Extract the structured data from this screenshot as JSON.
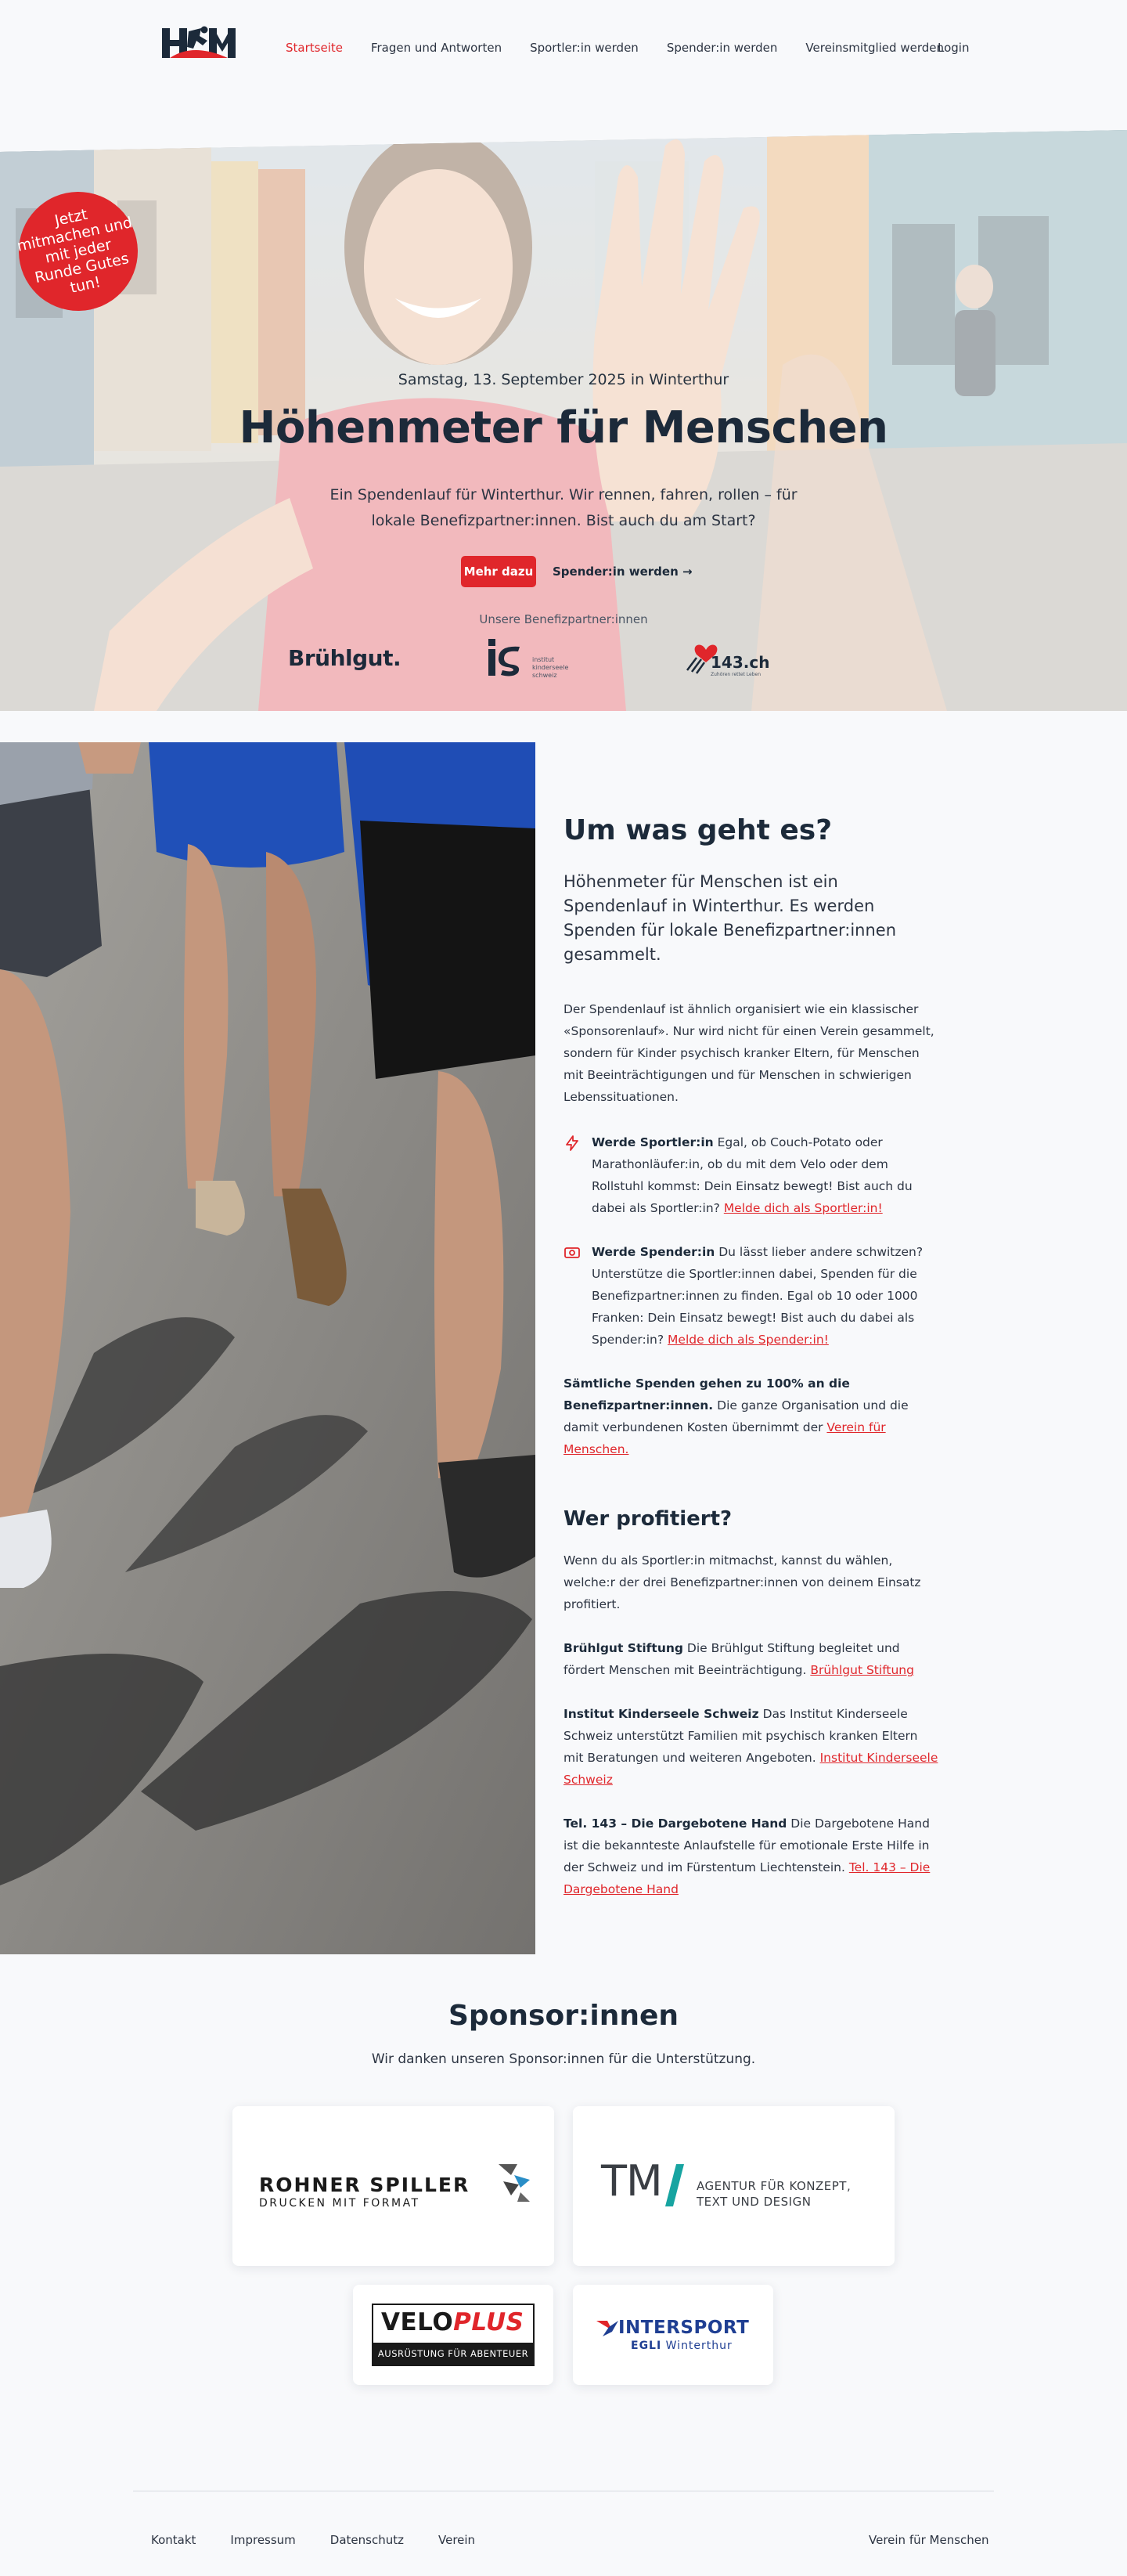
{
  "nav": {
    "logo_alt": "HfM",
    "items": [
      {
        "label": "Startseite",
        "active": true
      },
      {
        "label": "Fragen und Antworten"
      },
      {
        "label": "Sportler:in werden"
      },
      {
        "label": "Spender:in werden"
      },
      {
        "label": "Vereinsmitglied werden"
      }
    ],
    "login": "Login"
  },
  "hero": {
    "badge": "Jetzt mitmachen und mit jeder Runde Gutes tun!",
    "date": "Samstag, 13. September 2025 in Winterthur",
    "title": "Höhenmeter für Menschen",
    "description": "Ein Spendenlauf für Winterthur. Wir rennen, fahren, rollen – für lokale Benefizpartner:innen. Bist auch du am Start?",
    "primary_button": "Mehr dazu",
    "secondary_button": "Spender:in werden →",
    "partners_label": "Unsere Benefizpartner:innen",
    "partners": {
      "bruehlgut": "Brühlgut.",
      "iks_line1": "institut",
      "iks_line2": "kinderseele",
      "iks_line3": "schweiz",
      "tel143": "143.ch",
      "tel143_sub": "Zuhören rettet Leben"
    }
  },
  "about": {
    "title": "Um was geht es?",
    "lead": "Höhenmeter für Menschen ist ein Spendenlauf in Winterthur. Es werden Spenden für lokale Benefizpartner:innen gesammelt.",
    "intro": "Der Spendenlauf ist ähnlich organisiert wie ein klassischer «Sponsorenlauf». Nur wird nicht für einen Verein gesammelt, sondern für Kinder psychisch kranker Eltern, für Menschen mit Beeinträchtigungen und für Menschen in schwierigen Lebenssituationen.",
    "athlete_title": "Werde Sportler:in",
    "athlete_text": " Egal, ob Couch-Potato oder Marathonläufer:in, ob du mit dem Velo oder dem Rollstuhl kommst: Dein Einsatz bewegt! Bist auch du dabei als Sportler:in? ",
    "athlete_link": "Melde dich als Sportler:in!",
    "donor_title": "Werde Spender:in",
    "donor_text": " Du lässt lieber andere schwitzen? Unterstütze die Sportler:innen dabei, Spenden für die Benefizpartner:innen zu finden. Egal ob 10 oder 1000 Franken: Dein Einsatz bewegt! Bist auch du dabei als Spender:in? ",
    "donor_link": "Melde dich als Spender:in!",
    "all_title": "Sämtliche Spenden gehen zu 100% an die Benefizpartner:innen.",
    "all_text": " Die ganze Organisation und die damit verbundenen Kosten übernimmt der ",
    "all_link": "Verein für Menschen."
  },
  "benefit": {
    "title": "Wer profitiert?",
    "intro": "Wenn du als Sportler:in mitmachst, kannst du wählen, welche:r der drei Benefizpartner:innen von deinem Einsatz profitiert.",
    "p1_title": "Brühlgut Stiftung",
    "p1_text": " Die Brühlgut Stiftung begleitet und fördert Menschen mit Beeinträchtigung. ",
    "p1_link": "Brühlgut Stiftung",
    "p2_title": "Institut Kinderseele Schweiz",
    "p2_text": " Das Institut Kinderseele Schweiz unterstützt Familien mit psychisch kranken Eltern mit Beratungen und weiteren Angeboten. ",
    "p2_link": "Institut Kinderseele Schweiz",
    "p3_title": "Tel. 143 – Die Dargebotene Hand",
    "p3_text": " Die Dargebotene Hand ist die bekannteste Anlaufstelle für emotionale Erste Hilfe in der Schweiz und im Fürstentum Liechtenstein. ",
    "p3_link": "Tel. 143 – Die Dargebotene Hand"
  },
  "sponsors": {
    "title": "Sponsor:innen",
    "subtitle": "Wir danken unseren Sponsor:innen für die Unterstützung.",
    "rohner_name": "ROHNER SPILLER",
    "rohner_sub": "DRUCKEN MIT FORMAT",
    "tm_mark": "TM",
    "tm_line1": "AGENTUR FÜR KONZEPT,",
    "tm_line2": "TEXT UND DESIGN",
    "velo_a": "VELO",
    "velo_b": "PLUS",
    "velo_sub": "AUSRÜSTUNG FÜR ABENTEUER",
    "intersport": "INTERSPORT",
    "intersport_sub_a": "EGLI",
    "intersport_sub_b": " Winterthur"
  },
  "footer": {
    "links": [
      "Kontakt",
      "Impressum",
      "Datenschutz",
      "Verein"
    ],
    "right": "Verein für Menschen"
  },
  "colors": {
    "accent": "#e0262b",
    "navy": "#1c2a3a",
    "background": "#f8f9fb"
  }
}
